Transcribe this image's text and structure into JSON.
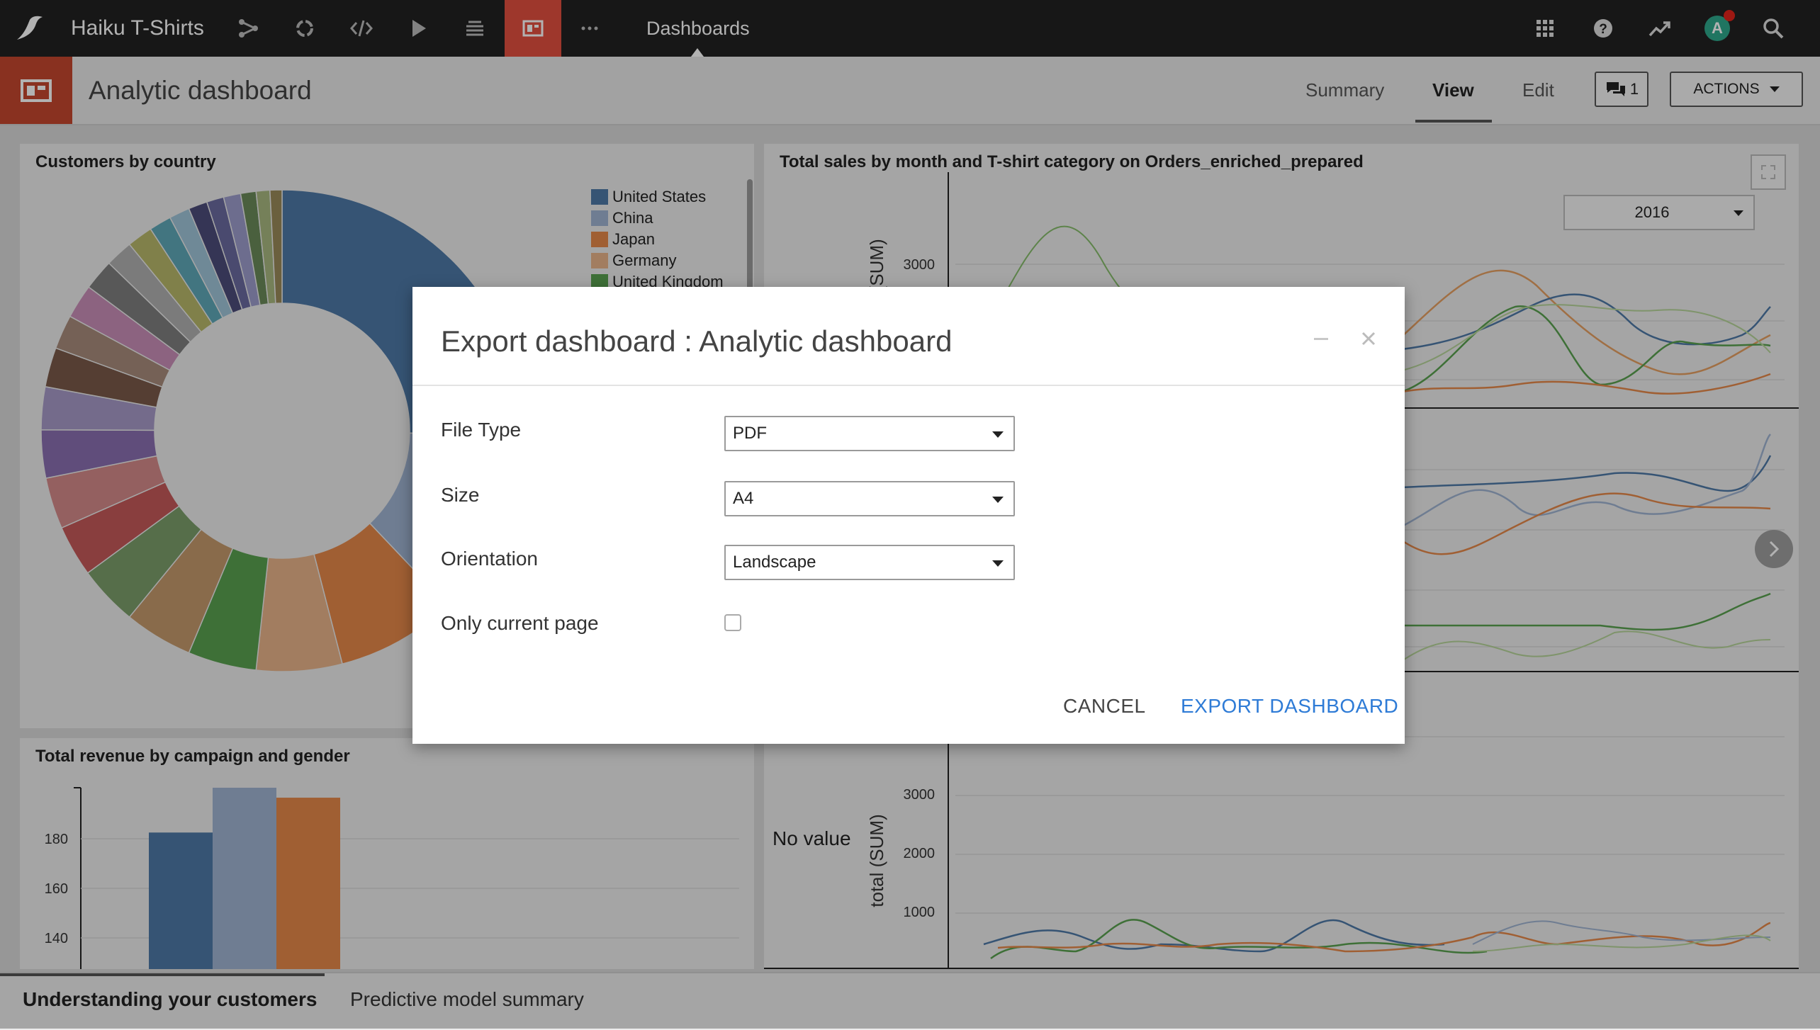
{
  "topnav": {
    "project_name": "Haiku T-Shirts",
    "section_label": "Dashboards",
    "icons": [
      "flow-icon",
      "recipes-icon",
      "code-icon",
      "jobs-icon",
      "datasets-stack-icon",
      "dashboards-icon",
      "more-icon"
    ],
    "right_icons": [
      "apps-grid-icon",
      "help-icon",
      "activity-icon",
      "user-avatar",
      "search-icon"
    ],
    "avatar_letter": "A",
    "brand_color": "#e3503f"
  },
  "header": {
    "title": "Analytic dashboard",
    "tabs": [
      "Summary",
      "View",
      "Edit"
    ],
    "active_tab": "View",
    "discussions_count": "1",
    "actions_label": "ACTIONS"
  },
  "tiles": {
    "customers": {
      "title": "Customers by country",
      "legend": [
        {
          "label": "United States",
          "color": "#4e79a7"
        },
        {
          "label": "China",
          "color": "#a0b4d1"
        },
        {
          "label": "Japan",
          "color": "#e6894a"
        },
        {
          "label": "Germany",
          "color": "#e8b48a"
        },
        {
          "label": "United Kingdom",
          "color": "#59a14f"
        }
      ]
    },
    "sales": {
      "title": "Total sales by month and T-shirt category on Orders_enriched_prepared",
      "year_filter": "2016",
      "y_ticks_top": [
        "3000"
      ],
      "y_label": "total (SUM)",
      "y_ticks_bottom": [
        "3000",
        "2000",
        "1000"
      ],
      "no_value_text": "No value"
    },
    "revenue": {
      "title": "Total revenue by campaign and gender",
      "y_ticks": [
        "180",
        "160",
        "140"
      ]
    }
  },
  "chart_data": [
    {
      "type": "pie",
      "title": "Customers by country",
      "categories": [
        "United States",
        "China",
        "Japan",
        "Germany",
        "United Kingdom"
      ],
      "values": [
        22,
        11,
        7,
        5,
        4
      ]
    },
    {
      "type": "bar",
      "title": "Total revenue by campaign and gender",
      "categories": [
        "bar-1",
        "bar-2",
        "bar-3"
      ],
      "values": [
        182,
        200,
        196
      ],
      "ylim": [
        130,
        200
      ],
      "colors": [
        "#4e79a7",
        "#a0b4d1",
        "#e6894a"
      ]
    }
  ],
  "modal": {
    "title": "Export dashboard : Analytic dashboard",
    "fields": [
      {
        "label": "File Type",
        "value": "PDF"
      },
      {
        "label": "Size",
        "value": "A4"
      },
      {
        "label": "Orientation",
        "value": "Landscape"
      }
    ],
    "checkbox_label": "Only current page",
    "checkbox_checked": false,
    "cancel_label": "CANCEL",
    "export_label": "EXPORT DASHBOARD",
    "accent_color": "#2e7bd6"
  },
  "page_tabs": [
    "Understanding your customers",
    "Predictive model summary"
  ]
}
